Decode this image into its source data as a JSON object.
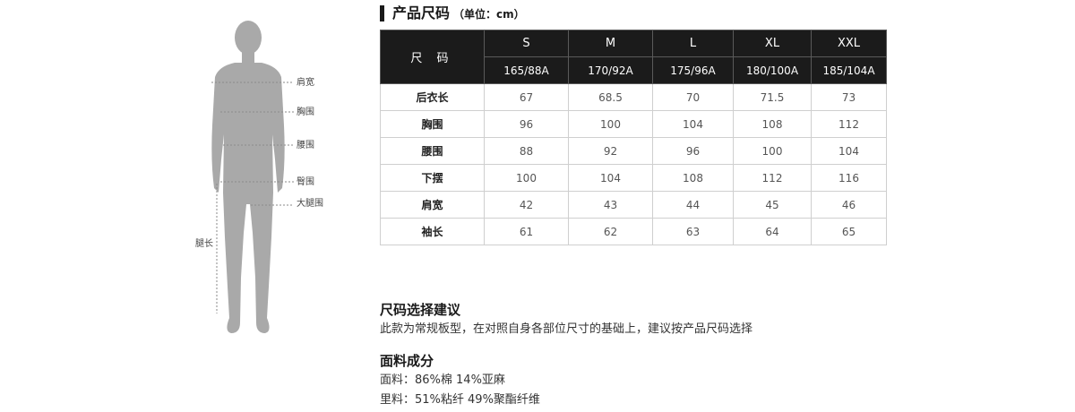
{
  "title": {
    "text": "产品尺码",
    "unit": "（单位：cm）"
  },
  "figure": {
    "labels": {
      "shoulder": "肩宽",
      "chest": "胸围",
      "waist": "腰围",
      "hip": "臀围",
      "thigh": "大腿围",
      "leg": "腿长"
    }
  },
  "table": {
    "corner": "尺 码",
    "sizes": [
      "S",
      "M",
      "L",
      "XL",
      "XXL"
    ],
    "specs": [
      "165/88A",
      "170/92A",
      "175/96A",
      "180/100A",
      "185/104A"
    ],
    "rows": [
      {
        "label": "后衣长",
        "values": [
          "67",
          "68.5",
          "70",
          "71.5",
          "73"
        ]
      },
      {
        "label": "胸围",
        "values": [
          "96",
          "100",
          "104",
          "108",
          "112"
        ]
      },
      {
        "label": "腰围",
        "values": [
          "88",
          "92",
          "96",
          "100",
          "104"
        ]
      },
      {
        "label": "下摆",
        "values": [
          "100",
          "104",
          "108",
          "112",
          "116"
        ]
      },
      {
        "label": "肩宽",
        "values": [
          "42",
          "43",
          "44",
          "45",
          "46"
        ]
      },
      {
        "label": "袖长",
        "values": [
          "61",
          "62",
          "63",
          "64",
          "65"
        ]
      }
    ]
  },
  "advice": {
    "heading": "尺码选择建议",
    "text": "此款为常规板型，在对照自身各部位尺寸的基础上，建议按产品尺码选择"
  },
  "fabric": {
    "heading": "面料成分",
    "face": "面料：86%棉 14%亚麻",
    "lining": "里料：51%粘纤 49%聚酯纤维"
  }
}
